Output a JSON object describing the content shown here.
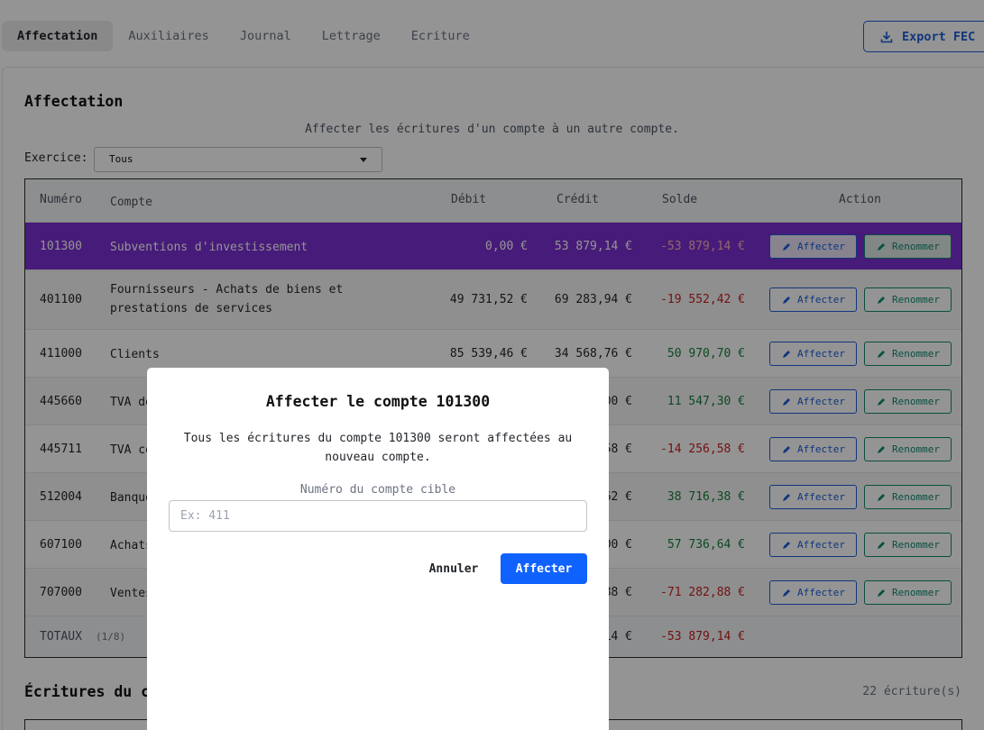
{
  "tabs": [
    "Affectation",
    "Auxiliaires",
    "Journal",
    "Lettrage",
    "Ecriture"
  ],
  "export_label": "Export FEC",
  "section_title": "Affectation",
  "subtitle": "Affecter les écritures d'un compte à un autre compte.",
  "exercice": {
    "label": "Exercice:",
    "value": "Tous"
  },
  "table": {
    "headers": {
      "num": "Numéro",
      "account": "Compte",
      "debit": "Débit",
      "credit": "Crédit",
      "balance": "Solde",
      "action": "Action"
    },
    "rows": [
      {
        "num": "101300",
        "account": "Subventions d'investissement",
        "account2": "",
        "debit": "0,00 €",
        "credit": "53 879,14 €",
        "balance": "-53 879,14 €"
      },
      {
        "num": "401100",
        "account": "Fournisseurs - Achats de biens et",
        "account2": "prestations de services",
        "debit": "49 731,52 €",
        "credit": "69 283,94 €",
        "balance": "-19 552,42 €"
      },
      {
        "num": "411000",
        "account": "Clients",
        "account2": "",
        "debit": "85 539,46 €",
        "credit": "34 568,76 €",
        "balance": "50 970,70 €"
      },
      {
        "num": "445660",
        "account": "TVA de",
        "account2": "",
        "debit": "",
        "credit": "00 €",
        "balance": "11 547,30 €"
      },
      {
        "num": "445711",
        "account": "TVA co",
        "account2": "",
        "debit": "",
        "credit": "58 €",
        "balance": "-14 256,58 €"
      },
      {
        "num": "512004",
        "account": "Banque",
        "account2": "",
        "debit": "",
        "credit": "62 €",
        "balance": "38 716,38 €"
      },
      {
        "num": "607100",
        "account": "Achats",
        "account2": "",
        "debit": "",
        "credit": "00 €",
        "balance": "57 736,64 €"
      },
      {
        "num": "707000",
        "account": "Ventes",
        "account2": "",
        "debit": "",
        "credit": "88 €",
        "balance": "-71 282,88 €"
      }
    ],
    "btn_affecter": "Affecter",
    "btn_renommer": "Renommer",
    "totals": {
      "label": "TOTAUX",
      "count": "(1/8)",
      "credit": "14 €",
      "balance": "-53 879,14 €"
    }
  },
  "section2": {
    "title_visible": "Écritures du c",
    "count": "22 écriture(s)"
  },
  "modal": {
    "title": "Affecter le compte 101300",
    "text": "Tous les écritures du compte 101300 seront affectées au nouveau compte.",
    "field_label": "Numéro du compte cible",
    "placeholder": "Ex: 411",
    "cancel": "Annuler",
    "confirm": "Affecter"
  },
  "colors": {
    "primary": "#0f62fe",
    "selected_row": "#7b2fd0",
    "negative": "#c81e1e",
    "positive": "#15803d",
    "rename": "#0f8a6e"
  }
}
